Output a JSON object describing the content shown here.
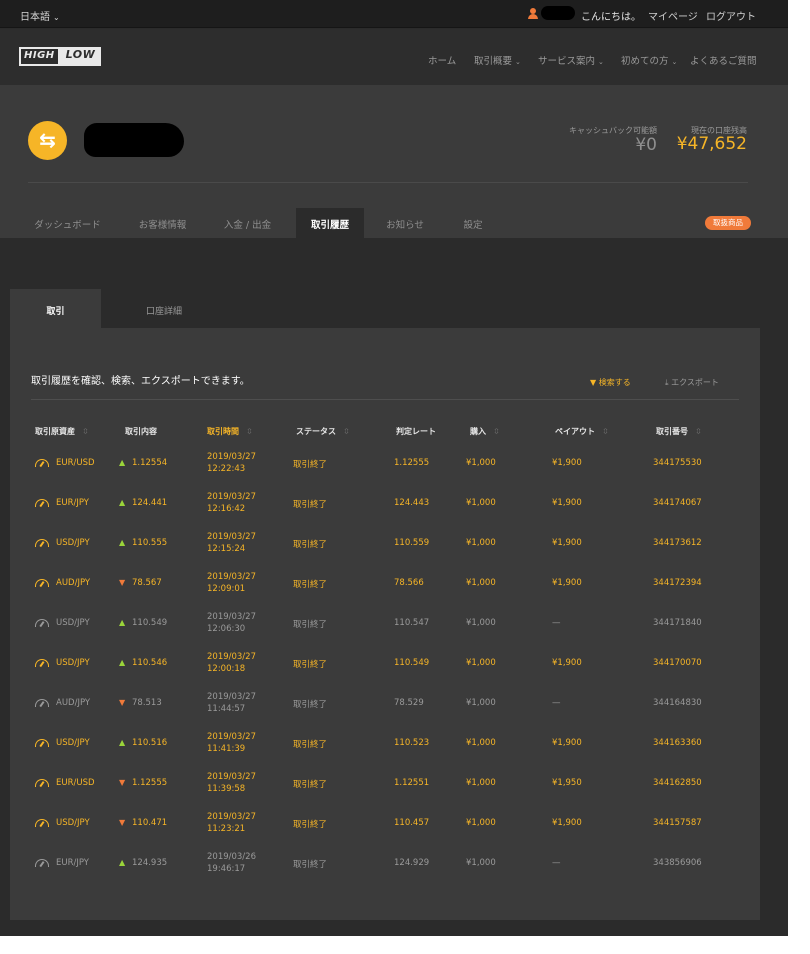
{
  "topbar": {
    "language": "日本語",
    "greeting": "こんにちは。",
    "mypage": "マイページ",
    "logout": "ログアウト"
  },
  "header": {
    "logo_high": "HIGH",
    "logo_low": "LOW",
    "nav": [
      {
        "label": "ホーム",
        "dropdown": false
      },
      {
        "label": "取引概要",
        "dropdown": true
      },
      {
        "label": "サービス案内",
        "dropdown": true
      },
      {
        "label": "初めての方",
        "dropdown": true
      },
      {
        "label": "よくあるご質問",
        "dropdown": false
      }
    ]
  },
  "profile": {
    "cashback_label": "キャッシュバック可能額",
    "cashback_value": "¥0",
    "balance_label": "現在の口座残高",
    "balance_value": "¥47,652",
    "tabs": [
      "ダッシュボード",
      "お客様情報",
      "入金 / 出金",
      "取引履歴",
      "お知らせ",
      "設定"
    ],
    "active_tab": "取引履歴",
    "badge": "取扱商品"
  },
  "content": {
    "subtabs": [
      "取引",
      "口座詳細"
    ],
    "description": "取引履歴を確認、検索、エクスポートできます。",
    "search_label": "検索する",
    "export_label": "エクスポート",
    "columns": [
      "取引原資産",
      "取引内容",
      "取引時間",
      "ステータス",
      "判定レート",
      "購入",
      "ペイアウト",
      "取引番号"
    ]
  },
  "rows": [
    {
      "asset": "EUR/USD",
      "dir": "up",
      "strike": "1.12554",
      "date": "2019/03/27",
      "time": "12:22:43",
      "status": "取引終了",
      "closing": "1.12555",
      "amount": "¥1,000",
      "payout": "¥1,900",
      "id": "344175530",
      "result": "win"
    },
    {
      "asset": "EUR/JPY",
      "dir": "up",
      "strike": "124.441",
      "date": "2019/03/27",
      "time": "12:16:42",
      "status": "取引終了",
      "closing": "124.443",
      "amount": "¥1,000",
      "payout": "¥1,900",
      "id": "344174067",
      "result": "win"
    },
    {
      "asset": "USD/JPY",
      "dir": "up",
      "strike": "110.555",
      "date": "2019/03/27",
      "time": "12:15:24",
      "status": "取引終了",
      "closing": "110.559",
      "amount": "¥1,000",
      "payout": "¥1,900",
      "id": "344173612",
      "result": "win"
    },
    {
      "asset": "AUD/JPY",
      "dir": "down",
      "strike": "78.567",
      "date": "2019/03/27",
      "time": "12:09:01",
      "status": "取引終了",
      "closing": "78.566",
      "amount": "¥1,000",
      "payout": "¥1,900",
      "id": "344172394",
      "result": "win"
    },
    {
      "asset": "USD/JPY",
      "dir": "up",
      "strike": "110.549",
      "date": "2019/03/27",
      "time": "12:06:30",
      "status": "取引終了",
      "closing": "110.547",
      "amount": "¥1,000",
      "payout": "—",
      "id": "344171840",
      "result": "lose"
    },
    {
      "asset": "USD/JPY",
      "dir": "up",
      "strike": "110.546",
      "date": "2019/03/27",
      "time": "12:00:18",
      "status": "取引終了",
      "closing": "110.549",
      "amount": "¥1,000",
      "payout": "¥1,900",
      "id": "344170070",
      "result": "win"
    },
    {
      "asset": "AUD/JPY",
      "dir": "down",
      "strike": "78.513",
      "date": "2019/03/27",
      "time": "11:44:57",
      "status": "取引終了",
      "closing": "78.529",
      "amount": "¥1,000",
      "payout": "—",
      "id": "344164830",
      "result": "lose"
    },
    {
      "asset": "USD/JPY",
      "dir": "up",
      "strike": "110.516",
      "date": "2019/03/27",
      "time": "11:41:39",
      "status": "取引終了",
      "closing": "110.523",
      "amount": "¥1,000",
      "payout": "¥1,900",
      "id": "344163360",
      "result": "win"
    },
    {
      "asset": "EUR/USD",
      "dir": "down",
      "strike": "1.12555",
      "date": "2019/03/27",
      "time": "11:39:58",
      "status": "取引終了",
      "closing": "1.12551",
      "amount": "¥1,000",
      "payout": "¥1,950",
      "id": "344162850",
      "result": "win"
    },
    {
      "asset": "USD/JPY",
      "dir": "down",
      "strike": "110.471",
      "date": "2019/03/27",
      "time": "11:23:21",
      "status": "取引終了",
      "closing": "110.457",
      "amount": "¥1,000",
      "payout": "¥1,900",
      "id": "344157587",
      "result": "win"
    },
    {
      "asset": "EUR/JPY",
      "dir": "up",
      "strike": "124.935",
      "date": "2019/03/26",
      "time": "19:46:17",
      "status": "取引終了",
      "closing": "124.929",
      "amount": "¥1,000",
      "payout": "—",
      "id": "343856906",
      "result": "lose"
    }
  ],
  "colors": {
    "accent": "#f6b527",
    "orange": "#f07a3a",
    "up": "#9bd43a",
    "muted": "#9a9a9a"
  }
}
